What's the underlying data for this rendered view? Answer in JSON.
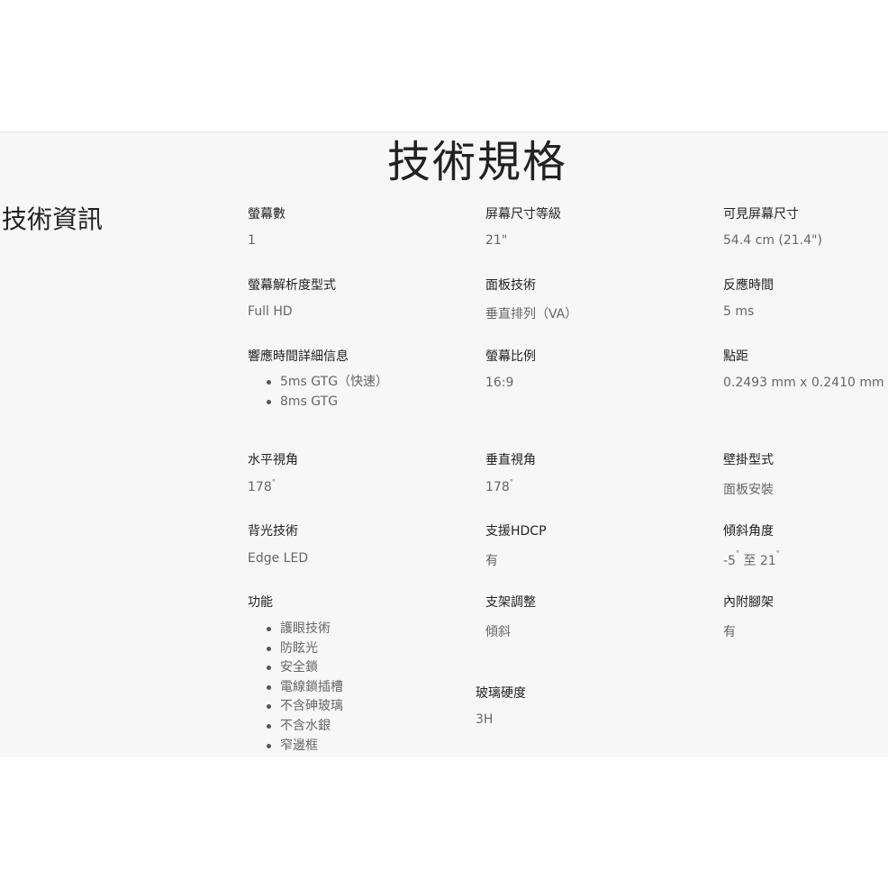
{
  "page_title": "技術規格",
  "section_title": "技術資訊",
  "specs": {
    "screens": {
      "label": "螢幕數",
      "value": "1"
    },
    "screen_size_class": {
      "label": "屏幕尺寸等級",
      "value": "21\""
    },
    "visible_size": {
      "label": "可見屏幕尺寸",
      "value": "54.4 cm (21.4\")"
    },
    "resolution": {
      "label": "螢幕解析度型式",
      "value": "Full HD"
    },
    "panel_tech": {
      "label": "面板技術",
      "value": "垂直排列（VA）"
    },
    "response_time": {
      "label": "反應時間",
      "value": "5 ms"
    },
    "response_detail": {
      "label": "響應時間詳細信息",
      "items": [
        "5ms GTG（快速）",
        "8ms GTG"
      ]
    },
    "aspect_ratio": {
      "label": "螢幕比例",
      "value": "16:9"
    },
    "dot_pitch": {
      "label": "點距",
      "value": "0.2493 mm x 0.2410 mm"
    },
    "h_view": {
      "label": "水平視角",
      "value": "178",
      "unit": "°"
    },
    "v_view": {
      "label": "垂直視角",
      "value": "178",
      "unit": "°"
    },
    "wall_mount": {
      "label": "壁掛型式",
      "value": "面板安裝"
    },
    "backlight": {
      "label": "背光技術",
      "value": "Edge LED"
    },
    "hdcp": {
      "label": "支援HDCP",
      "value": "有"
    },
    "tilt": {
      "label": "傾斜角度",
      "min": "-5",
      "sep": "至",
      "max": "21",
      "unit": "°"
    },
    "features": {
      "label": "功能",
      "items": [
        "護眼技術",
        "防眩光",
        "安全鎖",
        "電線鎖插槽",
        "不含砷玻璃",
        "不含水銀",
        "窄邊框"
      ]
    },
    "stand_adjust": {
      "label": "支架調整",
      "value": "傾斜"
    },
    "stand_included": {
      "label": "內附腳架",
      "value": "有"
    },
    "glass_hardness": {
      "label": "玻璃硬度",
      "value": "3H"
    }
  }
}
